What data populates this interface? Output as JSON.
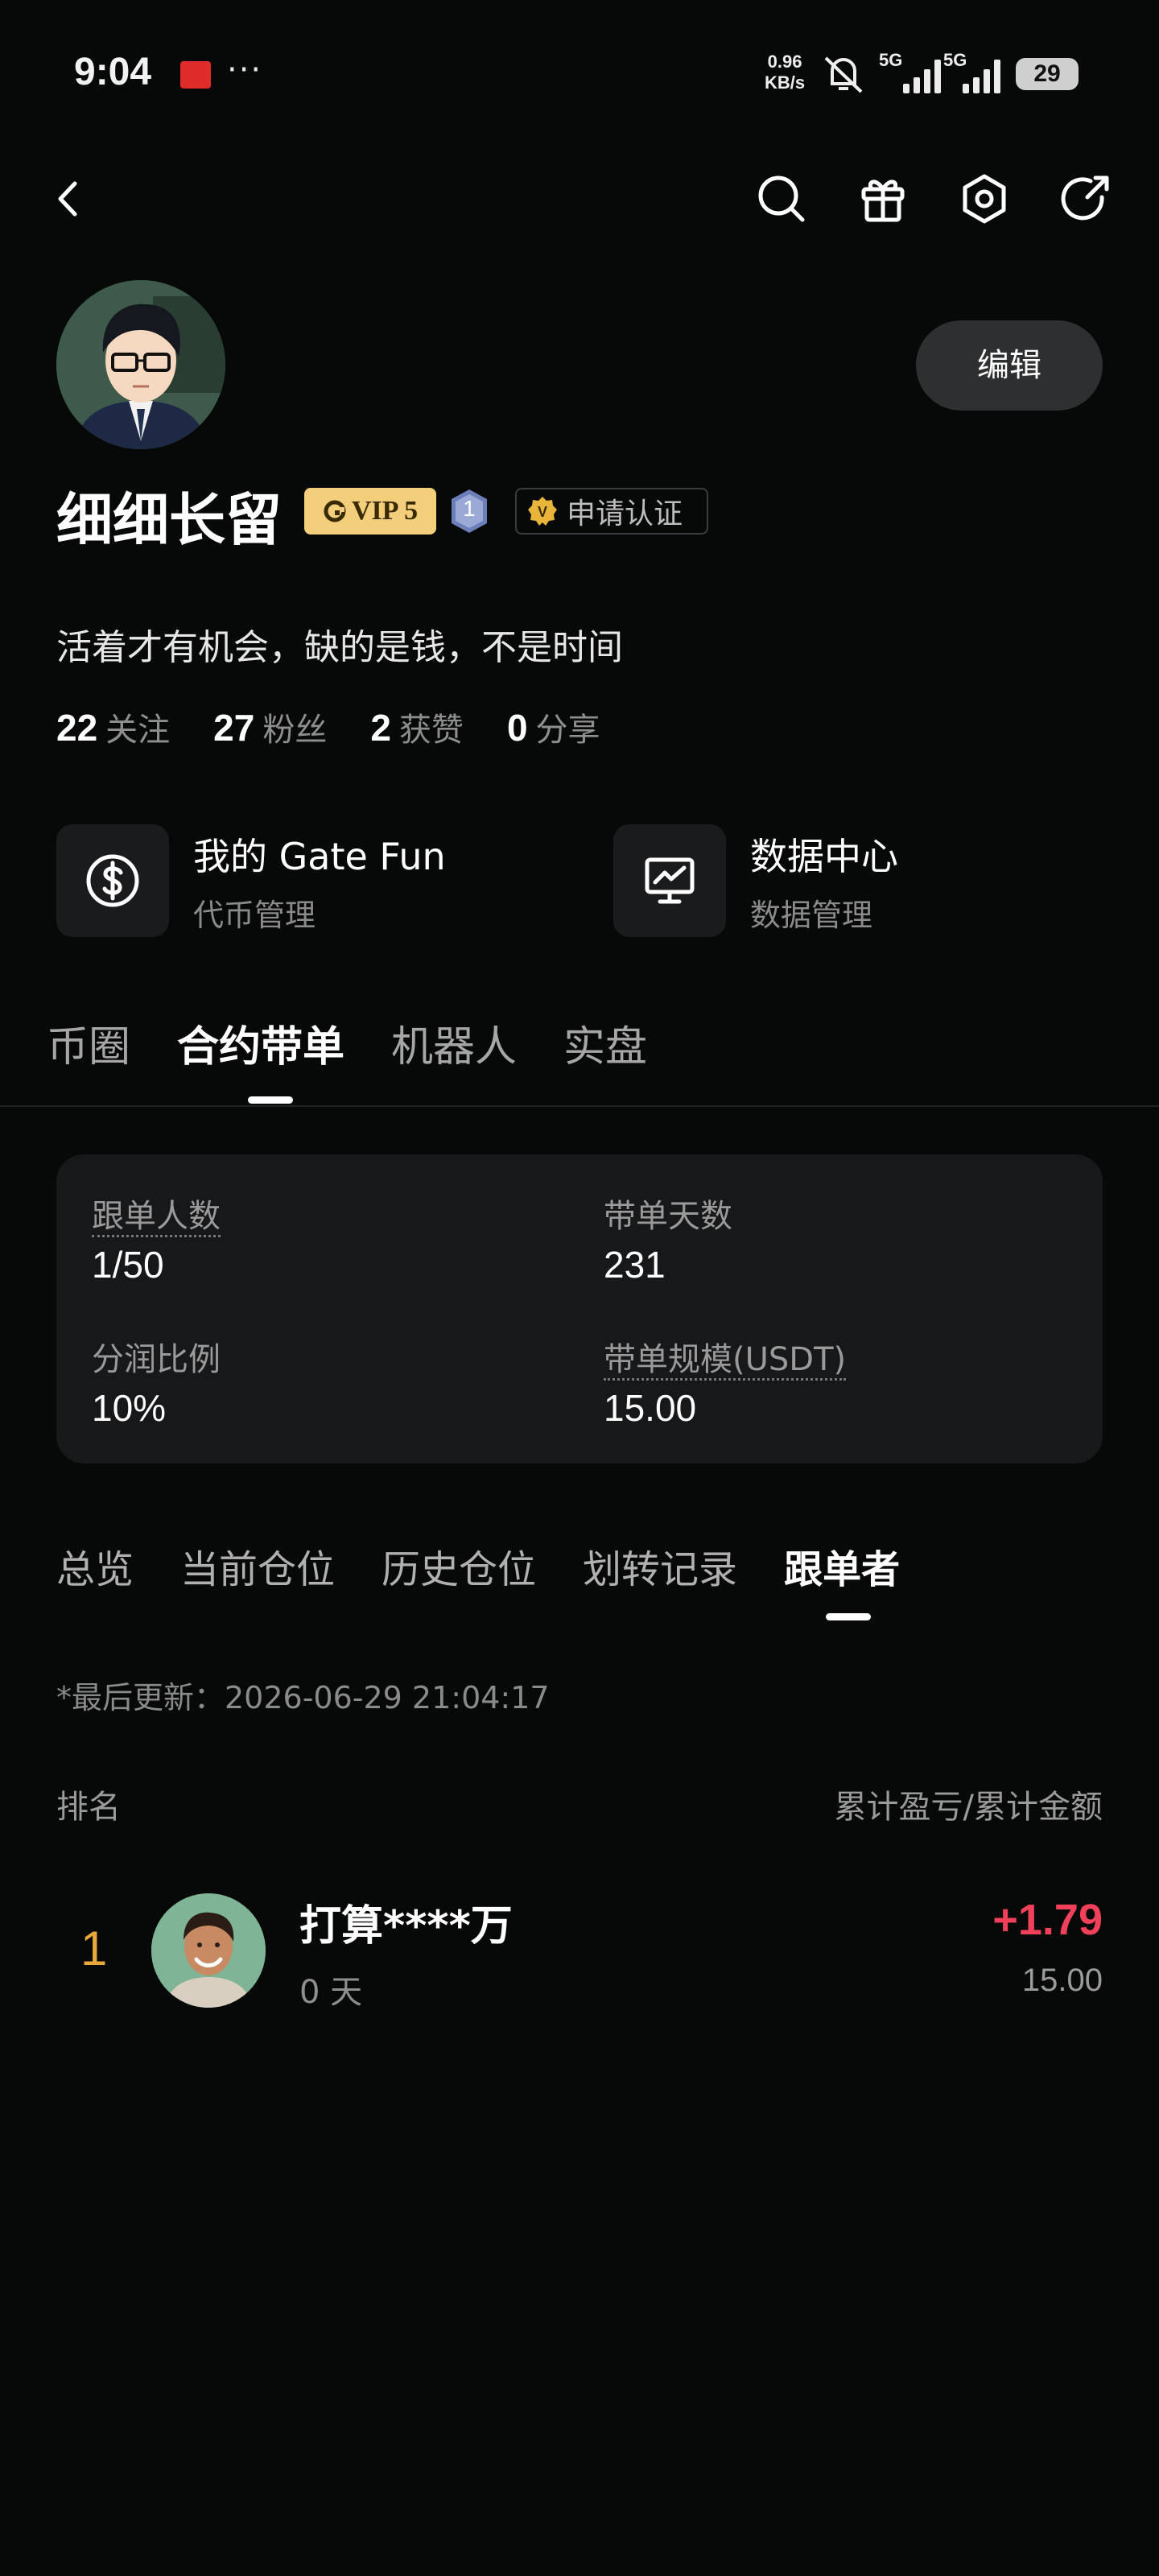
{
  "status_bar": {
    "time": "9:04",
    "speed_value": "0.96",
    "speed_unit": "KB/s",
    "net1": "5G",
    "net2": "5G",
    "battery": "29"
  },
  "profile": {
    "edit_label": "编辑",
    "username": "细细长留",
    "vip_label": "VIP 5",
    "level": "1",
    "verify_label": "申请认证",
    "bio": "活着才有机会，缺的是钱，不是时间",
    "stats": [
      {
        "num": "22",
        "label": "关注"
      },
      {
        "num": "27",
        "label": "粉丝"
      },
      {
        "num": "2",
        "label": "获赞"
      },
      {
        "num": "0",
        "label": "分享"
      }
    ]
  },
  "shortcuts": [
    {
      "title": "我的 Gate Fun",
      "subtitle": "代币管理",
      "icon": "dollar-circle-icon"
    },
    {
      "title": "数据中心",
      "subtitle": "数据管理",
      "icon": "chart-monitor-icon"
    }
  ],
  "main_tabs": [
    "币圈",
    "合约带单",
    "机器人",
    "实盘"
  ],
  "main_tabs_active": 1,
  "copy_stats": {
    "followers_label": "跟单人数",
    "followers_value": "1/50",
    "days_label": "带单天数",
    "days_value": "231",
    "share_label": "分润比例",
    "share_value": "10%",
    "scale_label": "带单规模(USDT)",
    "scale_value": "15.00"
  },
  "sub_tabs": [
    "总览",
    "当前仓位",
    "历史仓位",
    "划转记录",
    "跟单者"
  ],
  "sub_tabs_active": 4,
  "updated": "*最后更新：2026-06-29 21:04:17",
  "list_header": {
    "left": "排名",
    "right": "累计盈亏/累计金额"
  },
  "followers": [
    {
      "rank": "1",
      "name": "打算****万",
      "days": "0 天",
      "pnl": "+1.79",
      "amount": "15.00"
    }
  ],
  "colors": {
    "background": "#070808",
    "card": "#17181a",
    "pnl_positive": "#f0405a",
    "rank_gold": "#e9a93a",
    "vip_gold": "#f3cf7b"
  }
}
